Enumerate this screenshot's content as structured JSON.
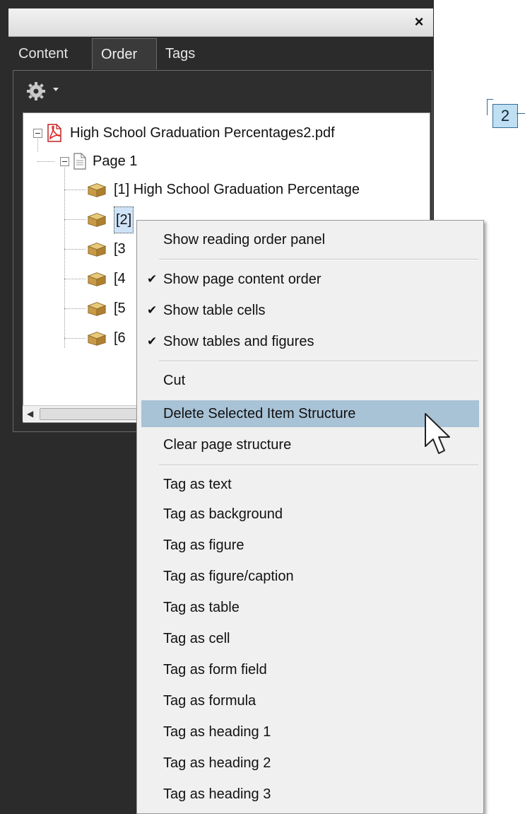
{
  "window": {
    "close_glyph": "×"
  },
  "tabs": [
    {
      "label": "Content"
    },
    {
      "label": "Order"
    },
    {
      "label": "Tags"
    }
  ],
  "tree": {
    "document_name": "High School Graduation Percentages2.pdf",
    "page_label": "Page 1",
    "items": [
      {
        "label": "[1]  High School Graduation Percentage"
      },
      {
        "label": "[2]"
      },
      {
        "label": "[3"
      },
      {
        "label": "[4"
      },
      {
        "label": "[5"
      },
      {
        "label": "[6"
      }
    ]
  },
  "page_view": {
    "order_badge": "2"
  },
  "context_menu": {
    "items": [
      {
        "label": "Show reading order panel",
        "accel": "w"
      },
      {
        "label": "Show page content order",
        "checked": true
      },
      {
        "label": "Show table cells",
        "checked": true
      },
      {
        "label": "Show tables and figures",
        "checked": true
      },
      {
        "label": "Cut"
      },
      {
        "label": "Delete Selected Item Structure",
        "highlighted": true
      },
      {
        "label": "Clear page structure"
      },
      {
        "label": "Tag as text"
      },
      {
        "label": "Tag as background"
      },
      {
        "label": "Tag as figure"
      },
      {
        "label": "Tag as figure/caption"
      },
      {
        "label": "Tag as table"
      },
      {
        "label": "Tag as cell"
      },
      {
        "label": "Tag as form field"
      },
      {
        "label": "Tag as formula"
      },
      {
        "label": "Tag as heading 1"
      },
      {
        "label": "Tag as heading 2"
      },
      {
        "label": "Tag as heading 3"
      }
    ],
    "check_glyph": "✔"
  },
  "colors": {
    "panel_bg": "#2b2b2b",
    "menu_highlight": "#a8c2d6",
    "badge_fill": "#bfe0f2"
  }
}
